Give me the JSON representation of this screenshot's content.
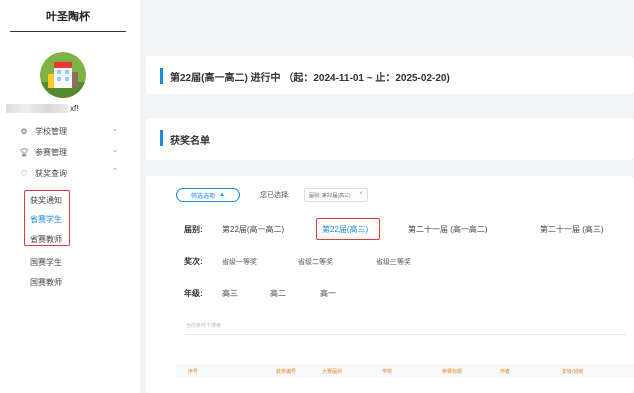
{
  "app": {
    "brand": "叶圣陶杯"
  },
  "user": {
    "name_suffix": "xf!"
  },
  "sidebar": {
    "menu": [
      {
        "label": "学校管理",
        "icon": "gear-icon"
      },
      {
        "label": "参赛管理",
        "icon": "trophy-icon"
      },
      {
        "label": "获奖查询",
        "icon": "heart-icon"
      }
    ],
    "subitems": [
      {
        "label": "获奖通知"
      },
      {
        "label": "省赛学生"
      },
      {
        "label": "省赛教师"
      },
      {
        "label": "国赛学生"
      },
      {
        "label": "国赛教师"
      }
    ]
  },
  "banner": {
    "title": "第22届(高一高二) 进行中 （起：2024-11-01 ~ 止：2025-02-20)"
  },
  "card": {
    "title": "获奖名单"
  },
  "filter": {
    "toggle_label": "筛选选项",
    "selected_label": "您已选择:",
    "chip_label": "届别: 第22届(高三)",
    "session": {
      "label": "届别:",
      "options": [
        "第22届(高一高二)",
        "第22届(高三)",
        "第二十一届 (高一高二)",
        "第二十一届 (高三)"
      ]
    },
    "award": {
      "label": "奖次:",
      "options": [
        "省级一等奖",
        "省级二等奖",
        "省级三等奖"
      ]
    },
    "grade": {
      "label": "年级:",
      "options": [
        "高三",
        "高二",
        "高一"
      ]
    },
    "hint": "当前条件下搜索"
  },
  "table": {
    "headers": [
      "序号",
      "获奖编号",
      "大赛届别",
      "学校",
      "参赛标题",
      "作者",
      "年级/班级"
    ]
  },
  "colors": {
    "accent": "#1e88e5",
    "highlight_box": "#e53935",
    "header_text": "#e08a2a"
  }
}
